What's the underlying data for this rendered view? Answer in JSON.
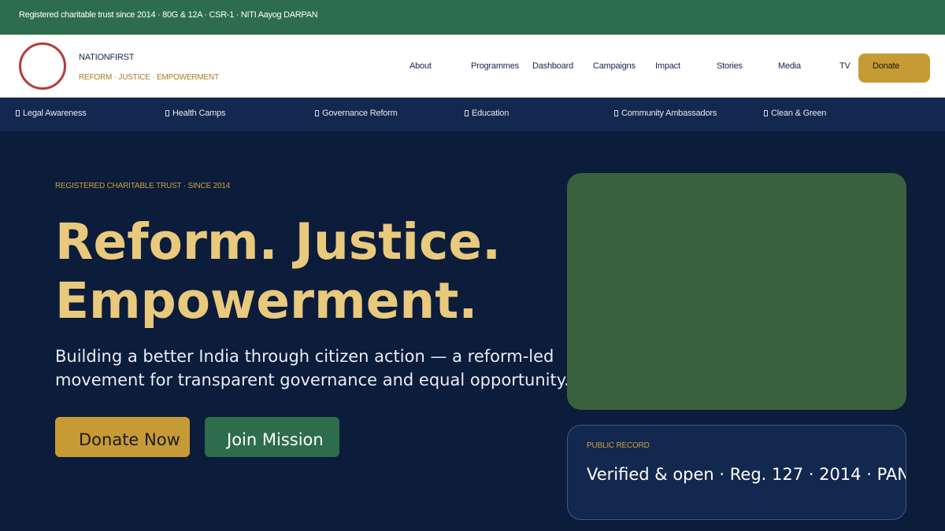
{
  "topbar": {
    "text": "Registered charitable trust since 2014 · 80G & 12A · CSR-1 · NITI Aayog DARPAN"
  },
  "brand": {
    "name": "NATIONFIRST",
    "tagline": "REFORM · JUSTICE · EMPOWERMENT",
    "logo_color": "#b83a3a"
  },
  "nav": {
    "items": [
      "About",
      "Programmes",
      "Dashboard",
      "Campaigns",
      "Impact",
      "Stories",
      "Media",
      "TV"
    ],
    "donate_label": "Donate"
  },
  "categories": {
    "items": [
      "Legal Awareness",
      "Health Camps",
      "Governance Reform",
      "Education",
      "Community Ambassadors",
      "Clean & Green"
    ]
  },
  "hero": {
    "eyebrow": "REGISTERED CHARITABLE TRUST · SINCE 2014",
    "title_line1": "Reform. Justice.",
    "title_line2": "Empowerment.",
    "subtitle_line1": "Building a better India through citizen action — a reform-led",
    "subtitle_line2": "movement for transparent governance and equal opportunity.",
    "primary_cta": "Donate Now",
    "secondary_cta": "Join Mission"
  },
  "record": {
    "label": "PUBLIC RECORD",
    "value": "Verified & open  ·  Reg. 127 · 2014  ·  PAN"
  },
  "colors": {
    "navy": "#0c1c3b",
    "navy_light": "#13284e",
    "green": "#2d6d4b",
    "gold": "#c69a34",
    "gold_text": "#e9c97c"
  }
}
